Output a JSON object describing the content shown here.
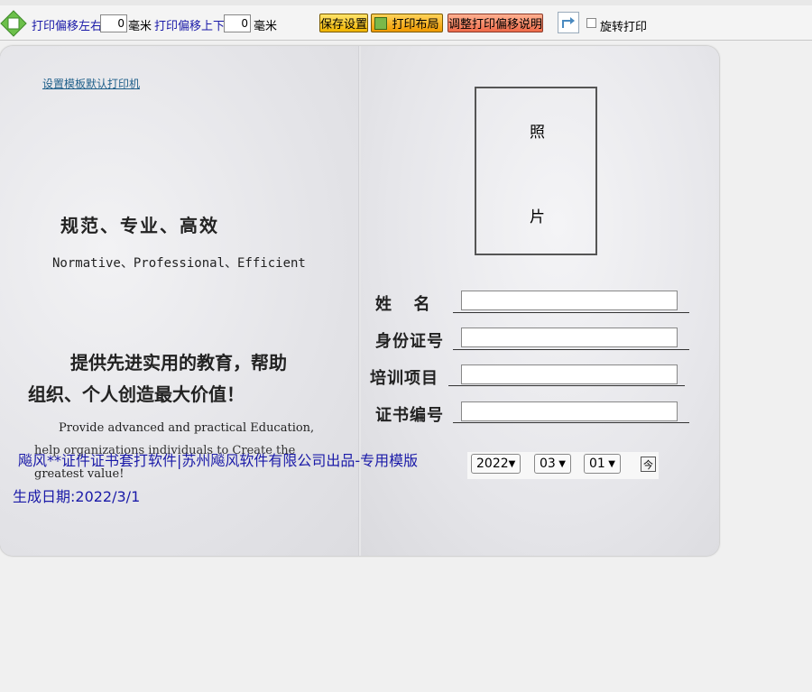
{
  "toolbar": {
    "offset_lr_label": "打印偏移左右",
    "offset_lr_value": "0",
    "offset_lr_unit": "毫米",
    "offset_ud_label": "打印偏移上下",
    "offset_ud_value": "0",
    "offset_ud_unit": "毫米",
    "save_label": "保存设置",
    "layout_label": "打印布局",
    "adjust_label": "调整打印偏移说明",
    "rotate_label": "旋转打印"
  },
  "certificate": {
    "printer_link": "设置模板默认打印机",
    "slogan_cn": "规范、专业、高效",
    "slogan_en": "Normative、Professional、Efficient",
    "desc_cn_1": "提供先进实用的教育，帮助",
    "desc_cn_2": "组织、个人创造最大价值！",
    "desc_en_1": "Provide advanced and practical Education,",
    "desc_en_2": "help organizations individuals to Create the",
    "desc_en_3": "greatest value!",
    "photo_char_1": "照",
    "photo_char_2": "片",
    "fields": {
      "name_label": "姓  名",
      "id_label": "身份证号",
      "training_label": "培训项目",
      "cert_no_label": "证书编号",
      "name_value": "",
      "id_value": "",
      "training_value": "",
      "cert_no_value": ""
    },
    "date": {
      "year": "2022",
      "month": "03",
      "day": "01",
      "today_button": "今"
    }
  },
  "overlay": {
    "product_text": "飚风**证件证书套打软件|苏州飚风软件有限公司出品-专用模版",
    "generated_date": "生成日期:2022/3/1"
  },
  "colors": {
    "link_blue": "#1a1aa8",
    "button_yellow": "#f0b400",
    "button_salmon": "#ef6b4a"
  }
}
